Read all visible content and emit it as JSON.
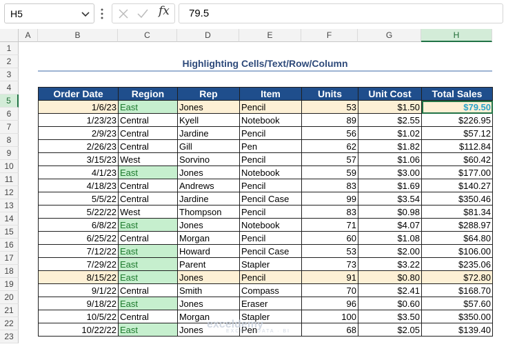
{
  "formula_bar": {
    "name_box": "H5",
    "fx_label": "fx",
    "value": "79.5"
  },
  "columns": [
    "A",
    "B",
    "C",
    "D",
    "E",
    "F",
    "G",
    "H"
  ],
  "rows": [
    "1",
    "2",
    "3",
    "4",
    "5",
    "6",
    "7",
    "8",
    "9",
    "10",
    "11",
    "12",
    "13",
    "14",
    "15",
    "16",
    "17",
    "18",
    "19",
    "20",
    "21",
    "22",
    "23"
  ],
  "selected_cell": {
    "column": "H",
    "row": "5"
  },
  "title": "Highlighting Cells/Text/Row/Column",
  "headers": [
    "Order Date",
    "Region",
    "Rep",
    "Item",
    "Units",
    "Unit Cost",
    "Total Sales"
  ],
  "table_rows": [
    [
      "1/6/23",
      "East",
      "Jones",
      "Pencil",
      "53",
      "$1.50",
      "$79.50"
    ],
    [
      "1/23/23",
      "Central",
      "Kyell",
      "Notebook",
      "89",
      "$2.55",
      "$226.95"
    ],
    [
      "2/9/23",
      "Central",
      "Jardine",
      "Pencil",
      "56",
      "$1.02",
      "$57.12"
    ],
    [
      "2/26/23",
      "Central",
      "Gill",
      "Pen",
      "62",
      "$1.82",
      "$112.84"
    ],
    [
      "3/15/23",
      "West",
      "Sorvino",
      "Pencil",
      "57",
      "$1.06",
      "$60.42"
    ],
    [
      "4/1/23",
      "East",
      "Jones",
      "Notebook",
      "59",
      "$3.00",
      "$177.00"
    ],
    [
      "4/18/23",
      "Central",
      "Andrews",
      "Pencil",
      "83",
      "$1.69",
      "$140.27"
    ],
    [
      "5/5/22",
      "Central",
      "Jardine",
      "Pencil Case",
      "99",
      "$3.54",
      "$350.46"
    ],
    [
      "5/22/22",
      "West",
      "Thompson",
      "Pencil",
      "83",
      "$0.98",
      "$81.34"
    ],
    [
      "6/8/22",
      "East",
      "Jones",
      "Notebook",
      "71",
      "$4.07",
      "$288.97"
    ],
    [
      "6/25/22",
      "Central",
      "Morgan",
      "Pencil",
      "60",
      "$1.08",
      "$64.80"
    ],
    [
      "7/12/22",
      "East",
      "Howard",
      "Pencil Case",
      "53",
      "$2.00",
      "$106.00"
    ],
    [
      "7/29/22",
      "East",
      "Parent",
      "Stapler",
      "73",
      "$3.22",
      "$235.06"
    ],
    [
      "8/15/22",
      "East",
      "Jones",
      "Pencil",
      "91",
      "$0.80",
      "$72.80"
    ],
    [
      "9/1/22",
      "Central",
      "Smith",
      "Compass",
      "70",
      "$2.41",
      "$168.70"
    ],
    [
      "9/18/22",
      "East",
      "Jones",
      "Eraser",
      "96",
      "$0.60",
      "$57.60"
    ],
    [
      "10/5/22",
      "Central",
      "Morgan",
      "Stapler",
      "100",
      "$3.50",
      "$350.00"
    ],
    [
      "10/22/22",
      "East",
      "Jones",
      "Pen",
      "68",
      "$2.05",
      "$139.40"
    ]
  ],
  "highlighted_rows": [
    0,
    13
  ],
  "highlight_color": "#fdf0d5",
  "east_fill_color": "#c6efce",
  "header_fill_color": "#1f4e8c",
  "watermark": {
    "name": "exceldemy",
    "tagline": "EXCEL · DATA · BI"
  }
}
